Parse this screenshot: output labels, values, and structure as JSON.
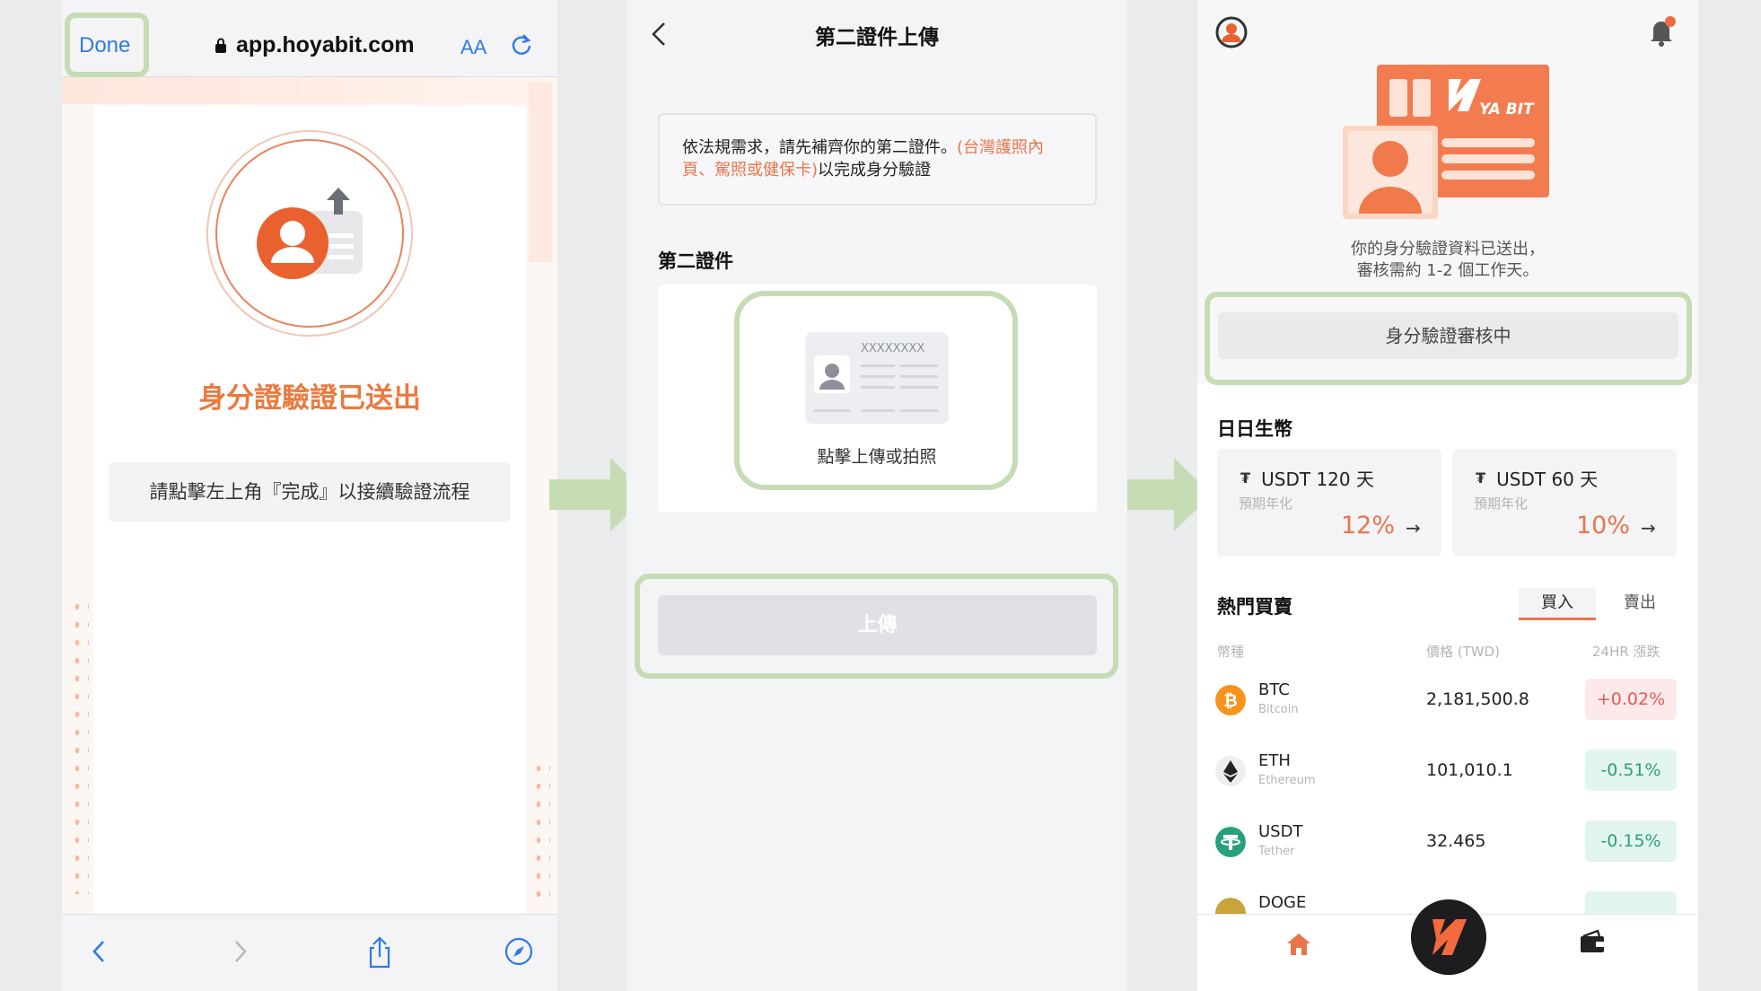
{
  "panel1": {
    "done_label": "Done",
    "url": "app.hoyabit.com",
    "text_size_label": "AA",
    "title": "身分證驗證已送出",
    "hint": "請點擊左上角『完成』以接續驗證流程"
  },
  "panel2": {
    "title": "第二證件上傳",
    "notice_plain_1": "依法規需求，請先補齊你的第二證件。",
    "notice_highlight": "(台灣護照內頁、駕照或健保卡)",
    "notice_plain_2": "以完成身分驗證",
    "section_label": "第二證件",
    "card_placeholder": "XXXXXXXX",
    "upload_prompt": "點擊上傳或拍照",
    "submit_label": "上傳"
  },
  "panel3": {
    "brand_text": "YA BIT",
    "message_line1": "你的身分驗證資料已送出，",
    "message_line2": "審核需約 1-2 個工作天。",
    "status_label": "身分驗證審核中",
    "daily_label": "日日生幣",
    "earn": [
      {
        "name": "USDT 120 天",
        "sub": "預期年化",
        "rate": "12%"
      },
      {
        "name": "USDT 60 天",
        "sub": "預期年化",
        "rate": "10%"
      }
    ],
    "hot_label": "熱門買賣",
    "tabs": [
      "買入",
      "賣出"
    ],
    "columns": [
      "幣種",
      "價格 (TWD)",
      "24HR 漲跌"
    ],
    "coins": [
      {
        "symbol": "BTC",
        "name": "Bitcoin",
        "price": "2,181,500.8",
        "change": "+0.02%",
        "color": "#f7931a"
      },
      {
        "symbol": "ETH",
        "name": "Ethereum",
        "price": "101,010.1",
        "change": "-0.51%",
        "color": "#eeeeee"
      },
      {
        "symbol": "USDT",
        "name": "Tether",
        "price": "32.465",
        "change": "-0.15%",
        "color": "#26a17b"
      },
      {
        "symbol": "DOGE",
        "name": "",
        "price": "",
        "change": "",
        "color": "#c8a43a"
      }
    ]
  },
  "colors": {
    "accent": "#e8754a",
    "highlight_frame": "#c5dcb5",
    "link_blue": "#2f7ae5",
    "up": "#e35a5a",
    "down": "#2ba077"
  }
}
